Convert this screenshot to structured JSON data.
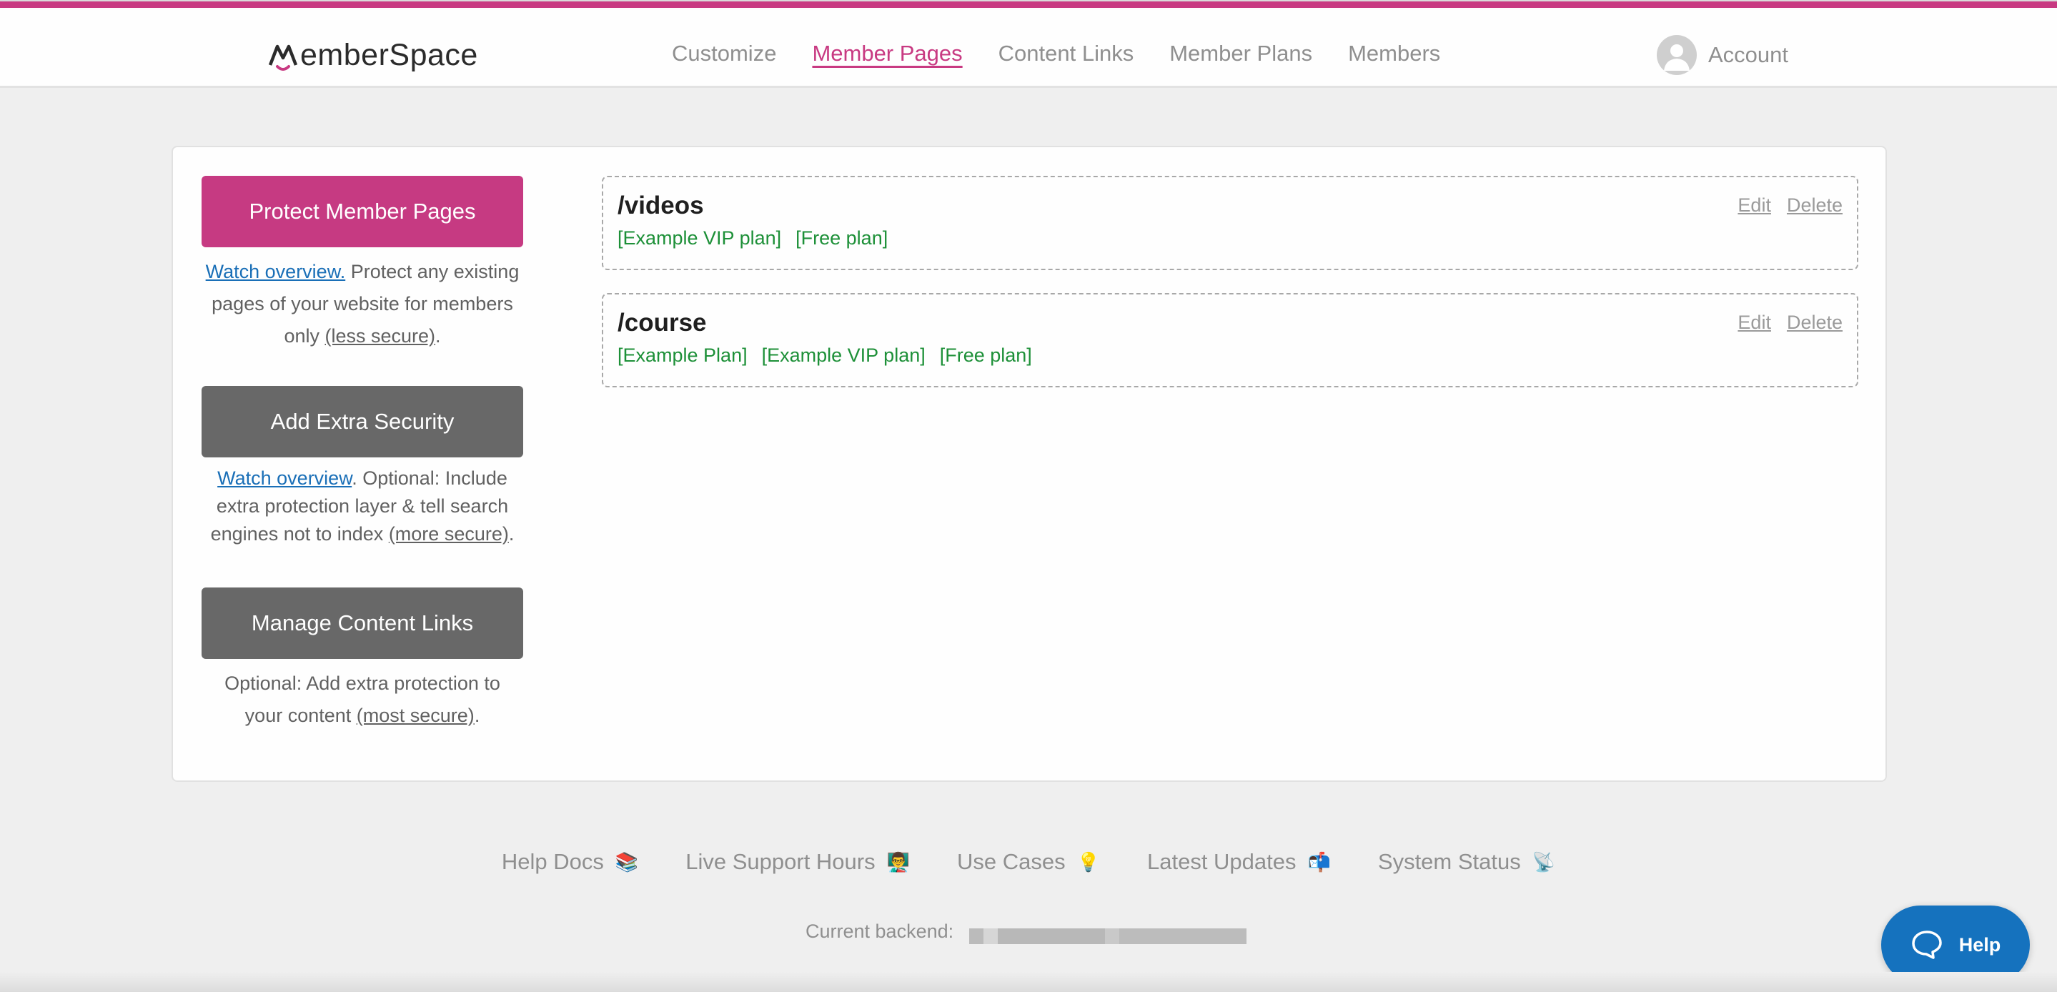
{
  "brand": {
    "name": "emberSpace",
    "accent": "#c83a82"
  },
  "nav": {
    "items": [
      {
        "label": "Customize",
        "active": false
      },
      {
        "label": "Member Pages",
        "active": true
      },
      {
        "label": "Content Links",
        "active": false
      },
      {
        "label": "Member Plans",
        "active": false
      },
      {
        "label": "Members",
        "active": false
      }
    ],
    "account_label": "Account"
  },
  "sidebar": {
    "protect": {
      "button": "Protect Member Pages",
      "link": "Watch overview.",
      "text": " Protect any existing pages of your website for members only ",
      "security": "(less secure)",
      "end": "."
    },
    "security": {
      "button": "Add Extra Security",
      "link": "Watch overview",
      "text": ". Optional: Include extra protection layer & tell search engines not to index ",
      "security": "(more secure)",
      "end": "."
    },
    "content": {
      "button": "Manage Content Links",
      "text": "Optional: Add extra protection to your content ",
      "security": "(most secure)",
      "end": "."
    }
  },
  "pages": [
    {
      "path": "/videos",
      "plans": [
        "[Example VIP plan]",
        "[Free plan]"
      ],
      "edit": "Edit",
      "delete": "Delete"
    },
    {
      "path": "/course",
      "plans": [
        "[Example Plan]",
        "[Example VIP plan]",
        "[Free plan]"
      ],
      "edit": "Edit",
      "delete": "Delete"
    }
  ],
  "footer": {
    "links": [
      {
        "label": "Help Docs",
        "emoji": "📚"
      },
      {
        "label": "Live Support Hours",
        "emoji": "👨‍🏫"
      },
      {
        "label": "Use Cases",
        "emoji": "💡"
      },
      {
        "label": "Latest Updates",
        "emoji": "📬"
      },
      {
        "label": "System Status",
        "emoji": "📡"
      }
    ],
    "backend_label": "Current backend:"
  },
  "help_widget": {
    "label": "Help"
  }
}
